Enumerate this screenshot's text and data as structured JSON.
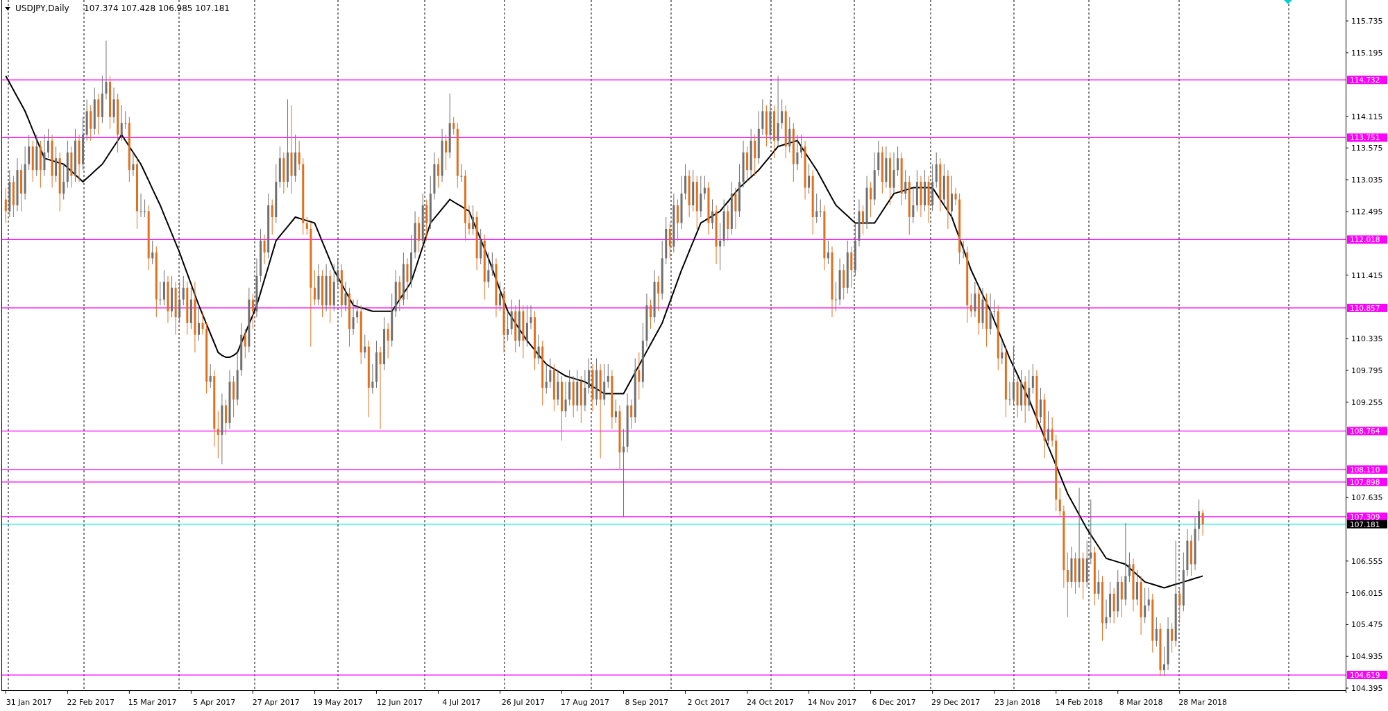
{
  "header": {
    "symbol": "USDJPY,Daily",
    "prices": "107.374 107.428 106.985 107.181"
  },
  "chart_data": {
    "type": "candlestick",
    "ylim": [
      104.36,
      116.09
    ],
    "categories": [
      null,
      null,
      null,
      null,
      null,
      null,
      "31 Jan 2017",
      null,
      null,
      null,
      null,
      null,
      null,
      null,
      null,
      null,
      null,
      null,
      null,
      null,
      null,
      null,
      "22 Feb 2017",
      null,
      null,
      null,
      null,
      null,
      null,
      null,
      null,
      null,
      null,
      null,
      null,
      null,
      null,
      null,
      "15 Mar 2017",
      null,
      null,
      null,
      null,
      null,
      null,
      null,
      null,
      null,
      null,
      null,
      null,
      null,
      null,
      null,
      "5 Apr 2017",
      null,
      null,
      null,
      null,
      null,
      null,
      null,
      null,
      null,
      null,
      null,
      null,
      null,
      null,
      null,
      "27 Apr 2017",
      null,
      null,
      null,
      null,
      null,
      null,
      null,
      null,
      null,
      null,
      null,
      null,
      null,
      null,
      null,
      "19 May 2017",
      null,
      null,
      null,
      null,
      null,
      null,
      null,
      null,
      null,
      null,
      null,
      null,
      null,
      null,
      null,
      "12 Jun 2017",
      null,
      null,
      null,
      null,
      null,
      null,
      null,
      null,
      null,
      null,
      null,
      null,
      null,
      null,
      null,
      "4 Jul 2017",
      null,
      null,
      null,
      null,
      null,
      null,
      null,
      null,
      null,
      null,
      null,
      null,
      null,
      null,
      null,
      "26 Jul 2017",
      null,
      null,
      null,
      null,
      null,
      null,
      null,
      null,
      null,
      null,
      null,
      null,
      null,
      null,
      null,
      "17 Aug 2017",
      null,
      null,
      null,
      null,
      null,
      null,
      null,
      null,
      null,
      null,
      null,
      null,
      null,
      null,
      null,
      "8 Sep 2017",
      null,
      null,
      null,
      null,
      null,
      null,
      null,
      null,
      null,
      null,
      null,
      null,
      null,
      null,
      null,
      "2 Oct 2017",
      null,
      null,
      null,
      null,
      null,
      null,
      null,
      null,
      null,
      null,
      null,
      null,
      null,
      null,
      null,
      "24 Oct 2017",
      null,
      null,
      null,
      null,
      null,
      null,
      null,
      null,
      null,
      null,
      null,
      null,
      null,
      null,
      null,
      "14 Nov 2017",
      null,
      null,
      null,
      null,
      null,
      null,
      null,
      null,
      null,
      null,
      null,
      null,
      null,
      null,
      null,
      "6 Dec 2017",
      null,
      null,
      null,
      null,
      null,
      null,
      null,
      null,
      null,
      null,
      null,
      null,
      null,
      null,
      null,
      "29 Dec 2017",
      null,
      null,
      null,
      null,
      null,
      null,
      null,
      null,
      null,
      null,
      null,
      null,
      null,
      null,
      null,
      "23 Jan 2018",
      null,
      null,
      null,
      null,
      null,
      null,
      null,
      null,
      null,
      null,
      null,
      null,
      null,
      null,
      null,
      "14 Feb 2018",
      null,
      null,
      null,
      null,
      null,
      null,
      null,
      null,
      null,
      null,
      null,
      null,
      null,
      null,
      null,
      "8 Mar 2018",
      null,
      null,
      null,
      null,
      null,
      null,
      null,
      null,
      null,
      null,
      null,
      null,
      null,
      null,
      null,
      "28 Mar 2018"
    ],
    "ohlc": [
      [
        112.7,
        112.9,
        112.3,
        112.5
      ],
      [
        112.5,
        113.2,
        112.4,
        113.0
      ],
      [
        113.0,
        113.1,
        112.4,
        112.6
      ],
      [
        112.6,
        113.4,
        112.5,
        113.2
      ],
      [
        113.2,
        113.3,
        112.5,
        112.8
      ],
      [
        112.8,
        113.6,
        112.7,
        113.3
      ],
      [
        113.3,
        113.8,
        113.2,
        113.6
      ],
      [
        113.6,
        113.7,
        113.0,
        113.2
      ],
      [
        113.2,
        113.8,
        113.1,
        113.6
      ],
      [
        113.6,
        113.7,
        112.9,
        113.2
      ],
      [
        113.2,
        113.8,
        113.1,
        113.5
      ],
      [
        113.5,
        113.9,
        113.4,
        113.7
      ],
      [
        113.7,
        113.8,
        112.9,
        113.1
      ],
      [
        113.1,
        113.6,
        113.0,
        113.4
      ],
      [
        113.4,
        113.5,
        112.5,
        112.8
      ],
      [
        112.8,
        113.3,
        112.7,
        113.0
      ],
      [
        113.0,
        113.7,
        112.9,
        113.5
      ],
      [
        113.5,
        113.6,
        112.9,
        113.1
      ],
      [
        113.1,
        113.9,
        113.0,
        113.7
      ],
      [
        113.7,
        113.8,
        113.0,
        113.3
      ],
      [
        113.3,
        114.1,
        113.2,
        113.8
      ],
      [
        113.8,
        114.4,
        113.7,
        114.2
      ],
      [
        114.2,
        114.3,
        113.7,
        113.9
      ],
      [
        113.9,
        114.6,
        113.8,
        114.4
      ],
      [
        114.4,
        114.5,
        113.8,
        114.1
      ],
      [
        114.1,
        114.8,
        114.0,
        114.5
      ],
      [
        114.5,
        115.4,
        114.4,
        114.7
      ],
      [
        114.7,
        114.8,
        113.9,
        114.1
      ],
      [
        114.1,
        114.6,
        114.0,
        114.4
      ],
      [
        114.4,
        114.5,
        113.5,
        113.8
      ],
      [
        113.8,
        114.3,
        113.7,
        114.0
      ],
      [
        114.0,
        114.2,
        113.9,
        114.0
      ],
      [
        114.0,
        114.1,
        113.0,
        113.2
      ],
      [
        113.2,
        113.5,
        113.1,
        113.3
      ],
      [
        113.3,
        113.4,
        112.2,
        112.5
      ],
      [
        112.5,
        112.8,
        112.4,
        112.5
      ],
      [
        112.5,
        112.7,
        112.4,
        112.5
      ],
      [
        112.5,
        112.6,
        111.5,
        111.7
      ],
      [
        111.7,
        112.0,
        111.6,
        111.8
      ],
      [
        111.8,
        111.9,
        110.7,
        111.0
      ],
      [
        111.0,
        111.3,
        110.9,
        111.0
      ],
      [
        111.0,
        111.5,
        110.9,
        111.3
      ],
      [
        111.3,
        111.4,
        110.6,
        110.8
      ],
      [
        110.8,
        111.4,
        110.7,
        111.2
      ],
      [
        111.2,
        111.3,
        110.4,
        110.7
      ],
      [
        110.7,
        111.3,
        110.6,
        111.0
      ],
      [
        111.0,
        111.4,
        110.9,
        111.2
      ],
      [
        111.2,
        111.3,
        110.4,
        110.6
      ],
      [
        110.6,
        111.2,
        110.5,
        111.0
      ],
      [
        111.0,
        111.3,
        110.1,
        110.4
      ],
      [
        110.4,
        110.9,
        110.3,
        110.6
      ],
      [
        110.6,
        110.8,
        110.4,
        110.5
      ],
      [
        110.5,
        110.6,
        109.4,
        109.6
      ],
      [
        109.6,
        109.9,
        109.5,
        109.7
      ],
      [
        109.7,
        109.8,
        108.5,
        108.8
      ],
      [
        108.8,
        109.1,
        108.3,
        108.7
      ],
      [
        108.7,
        109.4,
        108.2,
        109.2
      ],
      [
        109.2,
        109.3,
        108.7,
        108.9
      ],
      [
        108.9,
        109.8,
        108.8,
        109.6
      ],
      [
        109.6,
        109.7,
        109.0,
        109.3
      ],
      [
        109.3,
        110.1,
        109.2,
        109.8
      ],
      [
        109.8,
        110.6,
        109.7,
        110.4
      ],
      [
        110.4,
        110.5,
        110.0,
        110.2
      ],
      [
        110.2,
        111.2,
        110.1,
        111.0
      ],
      [
        111.0,
        111.1,
        110.5,
        110.8
      ],
      [
        110.8,
        111.7,
        110.7,
        111.4
      ],
      [
        111.4,
        112.2,
        111.3,
        112.0
      ],
      [
        112.0,
        112.1,
        111.6,
        111.8
      ],
      [
        111.8,
        112.8,
        111.7,
        112.6
      ],
      [
        112.6,
        112.7,
        112.1,
        112.4
      ],
      [
        112.4,
        113.3,
        112.3,
        113.0
      ],
      [
        113.0,
        113.6,
        112.9,
        113.4
      ],
      [
        113.4,
        113.5,
        112.8,
        113.0
      ],
      [
        113.0,
        114.4,
        112.9,
        113.5
      ],
      [
        113.5,
        114.3,
        112.8,
        113.1
      ],
      [
        113.1,
        113.8,
        113.0,
        113.5
      ],
      [
        113.5,
        113.7,
        113.2,
        113.3
      ],
      [
        113.3,
        113.4,
        112.1,
        112.3
      ],
      [
        112.3,
        112.4,
        112.1,
        112.2
      ],
      [
        112.2,
        112.3,
        110.2,
        111.2
      ],
      [
        111.2,
        111.5,
        110.9,
        111.0
      ],
      [
        111.0,
        111.6,
        110.9,
        111.4
      ],
      [
        111.4,
        111.5,
        110.7,
        110.9
      ],
      [
        110.9,
        111.6,
        110.8,
        111.4
      ],
      [
        111.4,
        111.5,
        110.6,
        110.9
      ],
      [
        110.9,
        111.6,
        110.8,
        111.3
      ],
      [
        111.3,
        111.7,
        111.2,
        111.5
      ],
      [
        111.5,
        111.6,
        110.7,
        110.9
      ],
      [
        110.9,
        111.3,
        110.8,
        111.1
      ],
      [
        111.1,
        111.2,
        110.2,
        110.5
      ],
      [
        110.5,
        111.0,
        110.4,
        110.7
      ],
      [
        110.7,
        111.0,
        110.6,
        110.8
      ],
      [
        110.8,
        110.9,
        109.9,
        110.1
      ],
      [
        110.1,
        110.4,
        110.0,
        110.2
      ],
      [
        110.2,
        110.3,
        109.0,
        109.5
      ],
      [
        109.5,
        109.9,
        109.4,
        109.6
      ],
      [
        109.6,
        110.3,
        109.5,
        110.1
      ],
      [
        110.1,
        110.2,
        108.8,
        109.9
      ],
      [
        109.9,
        110.7,
        109.8,
        110.5
      ],
      [
        110.5,
        110.6,
        110.0,
        110.3
      ],
      [
        110.3,
        111.1,
        110.2,
        110.8
      ],
      [
        110.8,
        111.5,
        110.7,
        111.3
      ],
      [
        111.3,
        111.4,
        110.8,
        111.0
      ],
      [
        111.0,
        111.8,
        110.9,
        111.6
      ],
      [
        111.6,
        111.7,
        111.0,
        111.3
      ],
      [
        111.3,
        112.1,
        111.2,
        111.8
      ],
      [
        111.8,
        112.5,
        111.7,
        112.3
      ],
      [
        112.3,
        112.4,
        111.8,
        112.0
      ],
      [
        112.0,
        112.8,
        111.9,
        112.6
      ],
      [
        112.6,
        112.7,
        112.0,
        112.3
      ],
      [
        112.3,
        113.1,
        112.2,
        112.8
      ],
      [
        112.8,
        113.5,
        112.7,
        113.3
      ],
      [
        113.3,
        113.4,
        112.9,
        113.1
      ],
      [
        113.1,
        113.9,
        113.0,
        113.7
      ],
      [
        113.7,
        113.8,
        113.2,
        113.5
      ],
      [
        113.5,
        114.5,
        113.4,
        114.0
      ],
      [
        114.0,
        114.1,
        113.8,
        113.9
      ],
      [
        113.9,
        114.0,
        112.9,
        113.1
      ],
      [
        113.1,
        113.3,
        113.0,
        113.1
      ],
      [
        113.1,
        113.2,
        112.0,
        112.3
      ],
      [
        112.3,
        112.6,
        112.1,
        112.2
      ],
      [
        112.2,
        112.6,
        112.1,
        112.4
      ],
      [
        112.4,
        112.5,
        111.5,
        111.7
      ],
      [
        111.7,
        112.2,
        111.6,
        112.0
      ],
      [
        112.0,
        112.1,
        111.0,
        111.3
      ],
      [
        111.3,
        111.8,
        111.2,
        111.5
      ],
      [
        111.5,
        111.8,
        111.4,
        111.6
      ],
      [
        111.6,
        111.7,
        110.7,
        110.9
      ],
      [
        110.9,
        111.3,
        110.8,
        111.1
      ],
      [
        111.1,
        111.2,
        110.1,
        110.4
      ],
      [
        110.4,
        110.8,
        110.3,
        110.5
      ],
      [
        110.5,
        111.0,
        110.4,
        110.8
      ],
      [
        110.8,
        110.9,
        110.1,
        110.3
      ],
      [
        110.3,
        111.0,
        110.2,
        110.8
      ],
      [
        110.8,
        110.9,
        110.0,
        110.3
      ],
      [
        110.3,
        110.9,
        110.2,
        110.6
      ],
      [
        110.6,
        110.9,
        110.5,
        110.7
      ],
      [
        110.7,
        110.8,
        109.8,
        110.0
      ],
      [
        110.0,
        110.4,
        109.9,
        110.2
      ],
      [
        110.2,
        110.3,
        109.2,
        109.5
      ],
      [
        109.5,
        109.9,
        109.4,
        109.6
      ],
      [
        109.6,
        110.0,
        109.5,
        109.8
      ],
      [
        109.8,
        109.9,
        109.1,
        109.3
      ],
      [
        109.3,
        109.8,
        109.2,
        109.6
      ],
      [
        109.6,
        109.7,
        108.6,
        109.1
      ],
      [
        109.1,
        109.6,
        109.0,
        109.3
      ],
      [
        109.3,
        109.8,
        109.2,
        109.6
      ],
      [
        109.6,
        109.7,
        109.0,
        109.2
      ],
      [
        109.2,
        109.8,
        109.1,
        109.6
      ],
      [
        109.6,
        109.7,
        108.9,
        109.2
      ],
      [
        109.2,
        109.8,
        109.1,
        109.5
      ],
      [
        109.5,
        110.0,
        109.4,
        109.8
      ],
      [
        109.8,
        109.9,
        109.1,
        109.3
      ],
      [
        109.3,
        110.0,
        109.2,
        109.8
      ],
      [
        109.8,
        109.9,
        108.3,
        109.3
      ],
      [
        109.3,
        109.9,
        109.2,
        109.6
      ],
      [
        109.6,
        109.9,
        109.5,
        109.7
      ],
      [
        109.7,
        109.8,
        108.8,
        109.0
      ],
      [
        109.0,
        109.3,
        108.9,
        109.1
      ],
      [
        109.1,
        109.2,
        108.1,
        108.4
      ],
      [
        108.4,
        108.8,
        107.3,
        108.5
      ],
      [
        108.5,
        109.4,
        108.4,
        109.2
      ],
      [
        109.2,
        109.3,
        108.8,
        109.0
      ],
      [
        109.0,
        110.0,
        108.9,
        109.8
      ],
      [
        109.8,
        110.1,
        109.3,
        109.6
      ],
      [
        109.6,
        110.6,
        109.5,
        110.3
      ],
      [
        110.3,
        111.1,
        110.2,
        110.9
      ],
      [
        110.9,
        111.0,
        110.5,
        110.7
      ],
      [
        110.7,
        111.5,
        110.6,
        111.3
      ],
      [
        111.3,
        111.4,
        110.8,
        111.1
      ],
      [
        111.1,
        112.0,
        111.0,
        111.7
      ],
      [
        111.7,
        112.4,
        111.6,
        112.2
      ],
      [
        112.2,
        112.3,
        111.7,
        111.9
      ],
      [
        111.9,
        112.8,
        111.8,
        112.6
      ],
      [
        112.6,
        112.7,
        112.0,
        112.3
      ],
      [
        112.3,
        113.1,
        112.2,
        112.8
      ],
      [
        112.8,
        113.3,
        112.7,
        113.1
      ],
      [
        113.1,
        113.2,
        112.4,
        112.6
      ],
      [
        112.6,
        113.2,
        112.5,
        113.0
      ],
      [
        113.0,
        113.1,
        112.2,
        112.5
      ],
      [
        112.5,
        113.1,
        112.4,
        112.8
      ],
      [
        112.8,
        113.1,
        112.7,
        112.9
      ],
      [
        112.9,
        113.0,
        112.1,
        112.3
      ],
      [
        112.3,
        112.7,
        112.2,
        112.5
      ],
      [
        112.5,
        112.6,
        111.6,
        111.9
      ],
      [
        111.9,
        112.3,
        111.5,
        112.0
      ],
      [
        112.0,
        112.7,
        111.9,
        112.5
      ],
      [
        112.5,
        112.6,
        112.0,
        112.2
      ],
      [
        112.2,
        113.0,
        112.1,
        112.8
      ],
      [
        112.8,
        112.9,
        112.2,
        112.5
      ],
      [
        112.5,
        113.3,
        112.4,
        113.0
      ],
      [
        113.0,
        113.7,
        112.9,
        113.5
      ],
      [
        113.5,
        113.6,
        113.0,
        113.2
      ],
      [
        113.2,
        113.9,
        113.1,
        113.7
      ],
      [
        113.7,
        113.8,
        113.1,
        113.4
      ],
      [
        113.4,
        114.2,
        113.3,
        113.9
      ],
      [
        113.9,
        114.4,
        113.8,
        114.2
      ],
      [
        114.2,
        114.3,
        113.6,
        113.8
      ],
      [
        113.8,
        114.4,
        113.7,
        114.2
      ],
      [
        114.2,
        114.3,
        113.4,
        113.7
      ],
      [
        113.7,
        114.8,
        113.6,
        114.0
      ],
      [
        114.0,
        114.4,
        113.9,
        114.2
      ],
      [
        114.2,
        114.3,
        113.4,
        113.6
      ],
      [
        113.6,
        114.1,
        113.5,
        113.9
      ],
      [
        113.9,
        114.0,
        113.0,
        113.3
      ],
      [
        113.3,
        113.8,
        113.2,
        113.5
      ],
      [
        113.5,
        113.8,
        113.4,
        113.6
      ],
      [
        113.6,
        113.7,
        112.7,
        112.9
      ],
      [
        112.9,
        113.3,
        112.8,
        113.1
      ],
      [
        113.1,
        113.2,
        112.1,
        112.4
      ],
      [
        112.4,
        112.8,
        112.3,
        112.5
      ],
      [
        112.5,
        112.7,
        112.4,
        112.5
      ],
      [
        112.5,
        112.6,
        111.5,
        111.7
      ],
      [
        111.7,
        112.0,
        111.6,
        111.8
      ],
      [
        111.8,
        111.9,
        110.7,
        111.0
      ],
      [
        111.0,
        111.3,
        110.8,
        111.0
      ],
      [
        111.0,
        111.7,
        110.9,
        111.5
      ],
      [
        111.5,
        111.6,
        111.0,
        111.2
      ],
      [
        111.2,
        112.0,
        111.1,
        111.8
      ],
      [
        111.8,
        111.9,
        111.2,
        111.5
      ],
      [
        111.5,
        112.3,
        111.4,
        112.0
      ],
      [
        112.0,
        112.7,
        111.9,
        112.5
      ],
      [
        112.5,
        112.6,
        112.1,
        112.3
      ],
      [
        112.3,
        113.1,
        112.2,
        112.9
      ],
      [
        112.9,
        113.0,
        112.4,
        112.7
      ],
      [
        112.7,
        113.5,
        112.6,
        113.2
      ],
      [
        113.2,
        113.7,
        113.1,
        113.5
      ],
      [
        113.5,
        113.6,
        112.8,
        113.0
      ],
      [
        113.0,
        113.6,
        112.9,
        113.4
      ],
      [
        113.4,
        113.5,
        112.6,
        112.9
      ],
      [
        112.9,
        113.5,
        112.8,
        113.2
      ],
      [
        113.2,
        113.6,
        113.1,
        113.4
      ],
      [
        113.4,
        113.5,
        112.6,
        112.8
      ],
      [
        112.8,
        113.2,
        112.7,
        113.0
      ],
      [
        113.0,
        113.1,
        112.1,
        112.4
      ],
      [
        112.4,
        112.9,
        112.3,
        112.6
      ],
      [
        112.6,
        113.2,
        112.5,
        113.0
      ],
      [
        113.0,
        113.1,
        112.4,
        112.6
      ],
      [
        112.6,
        113.2,
        112.5,
        113.0
      ],
      [
        113.0,
        113.1,
        112.3,
        112.6
      ],
      [
        112.6,
        113.3,
        112.5,
        113.0
      ],
      [
        113.0,
        113.5,
        112.9,
        113.3
      ],
      [
        113.3,
        113.4,
        112.5,
        112.7
      ],
      [
        112.7,
        113.3,
        112.6,
        113.1
      ],
      [
        113.1,
        113.2,
        112.2,
        112.5
      ],
      [
        112.5,
        113.1,
        112.4,
        112.8
      ],
      [
        112.8,
        112.9,
        112.6,
        112.7
      ],
      [
        112.7,
        112.8,
        111.6,
        111.8
      ],
      [
        111.8,
        112.0,
        111.7,
        111.8
      ],
      [
        111.8,
        111.9,
        110.6,
        110.9
      ],
      [
        110.9,
        111.1,
        110.7,
        110.8
      ],
      [
        110.8,
        111.3,
        110.7,
        111.1
      ],
      [
        111.1,
        111.2,
        110.4,
        110.6
      ],
      [
        110.6,
        111.2,
        110.5,
        111.0
      ],
      [
        111.0,
        111.1,
        110.2,
        110.5
      ],
      [
        110.5,
        111.1,
        110.4,
        110.8
      ],
      [
        110.8,
        111.0,
        110.7,
        110.8
      ],
      [
        110.8,
        110.9,
        109.8,
        110.0
      ],
      [
        110.0,
        110.3,
        109.9,
        110.1
      ],
      [
        110.1,
        110.2,
        109.0,
        109.3
      ],
      [
        109.3,
        109.6,
        109.2,
        109.3
      ],
      [
        109.3,
        110.2,
        109.2,
        109.6
      ],
      [
        109.6,
        109.7,
        109.0,
        109.2
      ],
      [
        109.2,
        109.8,
        109.1,
        109.6
      ],
      [
        109.6,
        109.7,
        108.9,
        109.2
      ],
      [
        109.2,
        109.8,
        109.1,
        109.5
      ],
      [
        109.5,
        109.9,
        109.4,
        109.7
      ],
      [
        109.7,
        109.8,
        108.8,
        109.0
      ],
      [
        109.0,
        109.5,
        108.9,
        109.3
      ],
      [
        109.3,
        109.4,
        108.3,
        108.6
      ],
      [
        108.6,
        109.1,
        108.5,
        108.8
      ],
      [
        108.8,
        109.0,
        108.5,
        108.6
      ],
      [
        108.6,
        108.7,
        107.4,
        107.6
      ],
      [
        107.6,
        107.8,
        107.3,
        107.4
      ],
      [
        107.4,
        107.5,
        106.1,
        106.4
      ],
      [
        106.4,
        106.7,
        105.6,
        106.2
      ],
      [
        106.2,
        106.8,
        106.1,
        106.6
      ],
      [
        106.6,
        106.7,
        106.0,
        106.2
      ],
      [
        106.2,
        107.8,
        106.1,
        106.6
      ],
      [
        106.6,
        106.7,
        105.9,
        106.2
      ],
      [
        106.2,
        106.9,
        106.1,
        106.6
      ],
      [
        106.6,
        107.6,
        106.5,
        106.7
      ],
      [
        106.7,
        106.8,
        105.8,
        106.0
      ],
      [
        106.0,
        106.4,
        105.9,
        106.2
      ],
      [
        106.2,
        106.3,
        105.2,
        105.5
      ],
      [
        105.5,
        105.9,
        105.4,
        105.6
      ],
      [
        105.6,
        106.2,
        105.5,
        106.0
      ],
      [
        106.0,
        106.1,
        105.5,
        105.7
      ],
      [
        105.7,
        106.4,
        105.6,
        106.2
      ],
      [
        106.2,
        106.3,
        105.6,
        105.9
      ],
      [
        105.9,
        107.2,
        105.8,
        106.3
      ],
      [
        106.3,
        106.7,
        106.2,
        106.5
      ],
      [
        106.5,
        106.6,
        105.7,
        105.9
      ],
      [
        105.9,
        106.4,
        105.8,
        106.2
      ],
      [
        106.2,
        106.3,
        105.3,
        105.6
      ],
      [
        105.6,
        106.1,
        105.5,
        105.8
      ],
      [
        105.8,
        106.1,
        105.7,
        105.9
      ],
      [
        105.9,
        106.0,
        105.0,
        105.2
      ],
      [
        105.2,
        105.6,
        105.1,
        105.4
      ],
      [
        105.4,
        105.5,
        104.6,
        104.7
      ],
      [
        104.7,
        105.1,
        104.6,
        104.8
      ],
      [
        104.8,
        105.6,
        104.7,
        105.4
      ],
      [
        105.4,
        105.5,
        105.0,
        105.2
      ],
      [
        105.2,
        106.9,
        105.1,
        106.0
      ],
      [
        106.0,
        106.1,
        105.5,
        105.8
      ],
      [
        105.8,
        106.7,
        105.7,
        106.4
      ],
      [
        106.4,
        107.1,
        106.3,
        106.9
      ],
      [
        106.9,
        107.0,
        106.3,
        106.5
      ],
      [
        106.5,
        107.3,
        106.4,
        107.1
      ],
      [
        107.1,
        107.6,
        106.9,
        107.4
      ],
      [
        107.374,
        107.428,
        106.985,
        107.181
      ]
    ],
    "series": [
      {
        "type": "line",
        "color": "#000000",
        "values": [
          114.8,
          114.68,
          114.56,
          114.44,
          114.32,
          114.2,
          114.04,
          113.88,
          113.72,
          113.56,
          113.4,
          113.38,
          113.36,
          113.34,
          113.32,
          113.3,
          113.24,
          113.18,
          113.12,
          113.06,
          113.0,
          113.06,
          113.12,
          113.18,
          113.24,
          113.3,
          113.4,
          113.5,
          113.6,
          113.7,
          113.8,
          113.7,
          113.6,
          113.5,
          113.4,
          113.3,
          113.16,
          113.02,
          112.88,
          112.74,
          112.6,
          112.44,
          112.28,
          112.12,
          111.96,
          111.8,
          111.62,
          111.44,
          111.26,
          111.08,
          110.9,
          110.74,
          110.58,
          110.42,
          110.26,
          110.1,
          110.05,
          110.02,
          110.02,
          110.05,
          110.1,
          110.26,
          110.42,
          110.58,
          110.74,
          110.9,
          111.12,
          111.34,
          111.56,
          111.78,
          112.0,
          112.08,
          112.16,
          112.24,
          112.32,
          112.4,
          112.38,
          112.36,
          112.34,
          112.32,
          112.3,
          112.14,
          111.98,
          111.82,
          111.66,
          111.5,
          111.38,
          111.26,
          111.14,
          111.02,
          110.9,
          110.88,
          110.86,
          110.84,
          110.82,
          110.8,
          110.8,
          110.8,
          110.8,
          110.8,
          110.8,
          110.9,
          111.0,
          111.1,
          111.2,
          111.3,
          111.5,
          111.7,
          111.9,
          112.1,
          112.3,
          112.38,
          112.46,
          112.54,
          112.62,
          112.7,
          112.66,
          112.62,
          112.58,
          112.54,
          112.5,
          112.34,
          112.18,
          112.02,
          111.86,
          111.7,
          111.52,
          111.34,
          111.16,
          110.98,
          110.8,
          110.7,
          110.6,
          110.5,
          110.4,
          110.3,
          110.22,
          110.14,
          110.06,
          109.98,
          109.9,
          109.86,
          109.82,
          109.78,
          109.74,
          109.7,
          109.68,
          109.66,
          109.64,
          109.62,
          109.6,
          109.56,
          109.52,
          109.48,
          109.44,
          109.4,
          109.4,
          109.4,
          109.4,
          109.4,
          109.4,
          109.52,
          109.64,
          109.76,
          109.88,
          110.0,
          110.12,
          110.24,
          110.36,
          110.48,
          110.6,
          110.78,
          110.96,
          111.14,
          111.32,
          111.5,
          111.66,
          111.82,
          111.98,
          112.14,
          112.3,
          112.34,
          112.38,
          112.42,
          112.46,
          112.5,
          112.58,
          112.66,
          112.74,
          112.82,
          112.9,
          112.96,
          113.02,
          113.08,
          113.14,
          113.2,
          113.28,
          113.36,
          113.44,
          113.52,
          113.6,
          113.62,
          113.64,
          113.66,
          113.68,
          113.7,
          113.6,
          113.5,
          113.4,
          113.3,
          113.2,
          113.08,
          112.96,
          112.84,
          112.72,
          112.6,
          112.54,
          112.48,
          112.42,
          112.36,
          112.3,
          112.3,
          112.3,
          112.3,
          112.3,
          112.3,
          112.4,
          112.5,
          112.6,
          112.7,
          112.8,
          112.82,
          112.84,
          112.86,
          112.88,
          112.9,
          112.9,
          112.9,
          112.9,
          112.9,
          112.9,
          112.8,
          112.7,
          112.6,
          112.5,
          112.4,
          112.22,
          112.04,
          111.86,
          111.68,
          111.5,
          111.36,
          111.22,
          111.08,
          110.94,
          110.8,
          110.64,
          110.48,
          110.32,
          110.16,
          110.0,
          109.86,
          109.72,
          109.58,
          109.44,
          109.3,
          109.14,
          108.98,
          108.82,
          108.66,
          108.5,
          108.34,
          108.18,
          108.02,
          107.86,
          107.7,
          107.58,
          107.46,
          107.34,
          107.22,
          107.1,
          107.0,
          106.9,
          106.8,
          106.7,
          106.6,
          106.58,
          106.56,
          106.54,
          106.52,
          106.5,
          106.44,
          106.38,
          106.32,
          106.26,
          106.2,
          106.18,
          106.16,
          106.14,
          106.12,
          106.1,
          106.12,
          106.14,
          106.16,
          106.18,
          106.2,
          106.22,
          106.24,
          106.26,
          106.28,
          106.3
        ]
      }
    ],
    "yticks": [
      {
        "value": 115.735,
        "label": "115.735"
      },
      {
        "value": 115.195,
        "label": "115.195"
      },
      {
        "value": 114.115,
        "label": "114.115"
      },
      {
        "value": 113.575,
        "label": "113.575"
      },
      {
        "value": 113.035,
        "label": "113.035"
      },
      {
        "value": 112.495,
        "label": "112.495"
      },
      {
        "value": 111.415,
        "label": "111.415"
      },
      {
        "value": 110.335,
        "label": "110.335"
      },
      {
        "value": 109.795,
        "label": "109.795"
      },
      {
        "value": 109.255,
        "label": "109.255"
      },
      {
        "value": 107.635,
        "label": "107.635"
      },
      {
        "value": 106.555,
        "label": "106.555"
      },
      {
        "value": 106.015,
        "label": "106.015"
      },
      {
        "value": 105.475,
        "label": "105.475"
      },
      {
        "value": 104.935,
        "label": "104.935"
      },
      {
        "value": 104.395,
        "label": "104.395"
      }
    ],
    "ref_lines": [
      {
        "axis": "y",
        "value": 114.732,
        "label": "114.732",
        "color": "#ff00ff"
      },
      {
        "axis": "y",
        "value": 113.751,
        "label": "113.751",
        "color": "#ff00ff"
      },
      {
        "axis": "y",
        "value": 112.018,
        "label": "112.018",
        "color": "#ff00ff"
      },
      {
        "axis": "y",
        "value": 110.857,
        "label": "110.857",
        "color": "#ff00ff"
      },
      {
        "axis": "y",
        "value": 108.764,
        "label": "108.764",
        "color": "#ff00ff"
      },
      {
        "axis": "y",
        "value": 108.11,
        "label": "108.110",
        "color": "#ff00ff"
      },
      {
        "axis": "y",
        "value": 107.898,
        "label": "107.898",
        "color": "#ff00ff"
      },
      {
        "axis": "y",
        "value": 107.309,
        "label": "107.309",
        "color": "#ff00ff"
      },
      {
        "axis": "y",
        "value": 107.181,
        "label": "107.181",
        "color": "#00e5e5"
      },
      {
        "axis": "y",
        "value": 104.619,
        "label": "104.619",
        "color": "#ff00ff"
      }
    ]
  }
}
